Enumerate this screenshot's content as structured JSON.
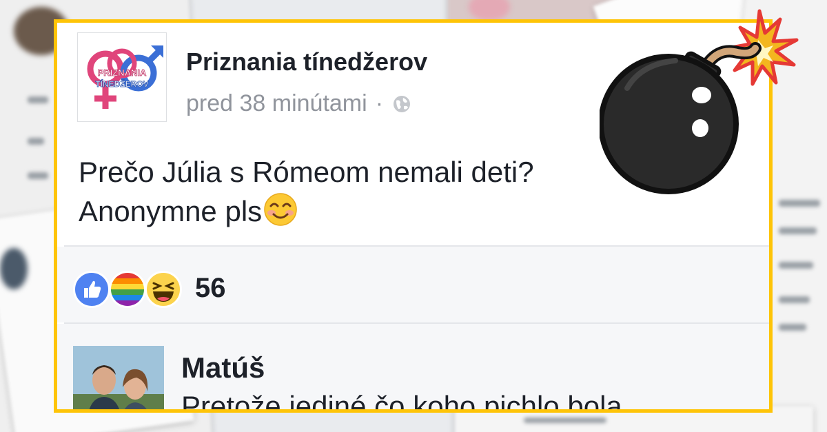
{
  "post": {
    "page_name": "Priznania tínedžerov",
    "timestamp": "pred 38 minútami",
    "separator": "·",
    "text_line1": "Prečo Júlia s Rómeom nemali deti?",
    "text_line2": "Anonymne pls",
    "reaction_count": "56",
    "reactions": [
      "like-icon",
      "pride-icon",
      "haha-icon"
    ]
  },
  "logo": {
    "line1": "PRIZNANIA",
    "line2": "TÍNEDŽEROV"
  },
  "comment": {
    "author": "Matúš",
    "text": "Pretože jediné čo koho pichlo bola"
  },
  "colors": {
    "frame": "#fec407",
    "like": "#4f82f1",
    "text": "#1d2129",
    "meta": "#90949c"
  }
}
